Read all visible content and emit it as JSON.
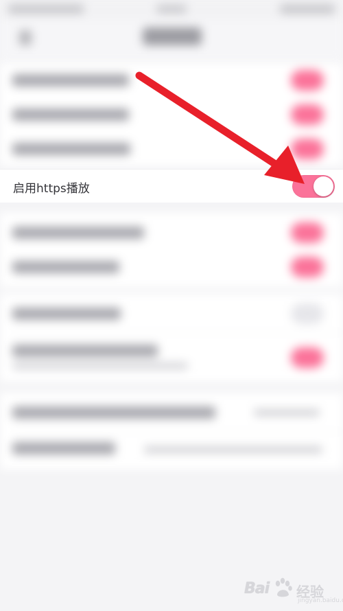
{
  "focused_setting": {
    "label": "启用https播放",
    "toggle_on": true
  },
  "colors": {
    "accent": "#fb7299",
    "arrow": "#e8202a",
    "background": "#f4f4f6"
  },
  "watermark": {
    "brand": "Bai",
    "brand_cn": "经验",
    "domain": "jingyan.baidu.com"
  },
  "icons": {
    "arrow": "pointer-arrow",
    "watermark": "baidu-paw-icon"
  }
}
